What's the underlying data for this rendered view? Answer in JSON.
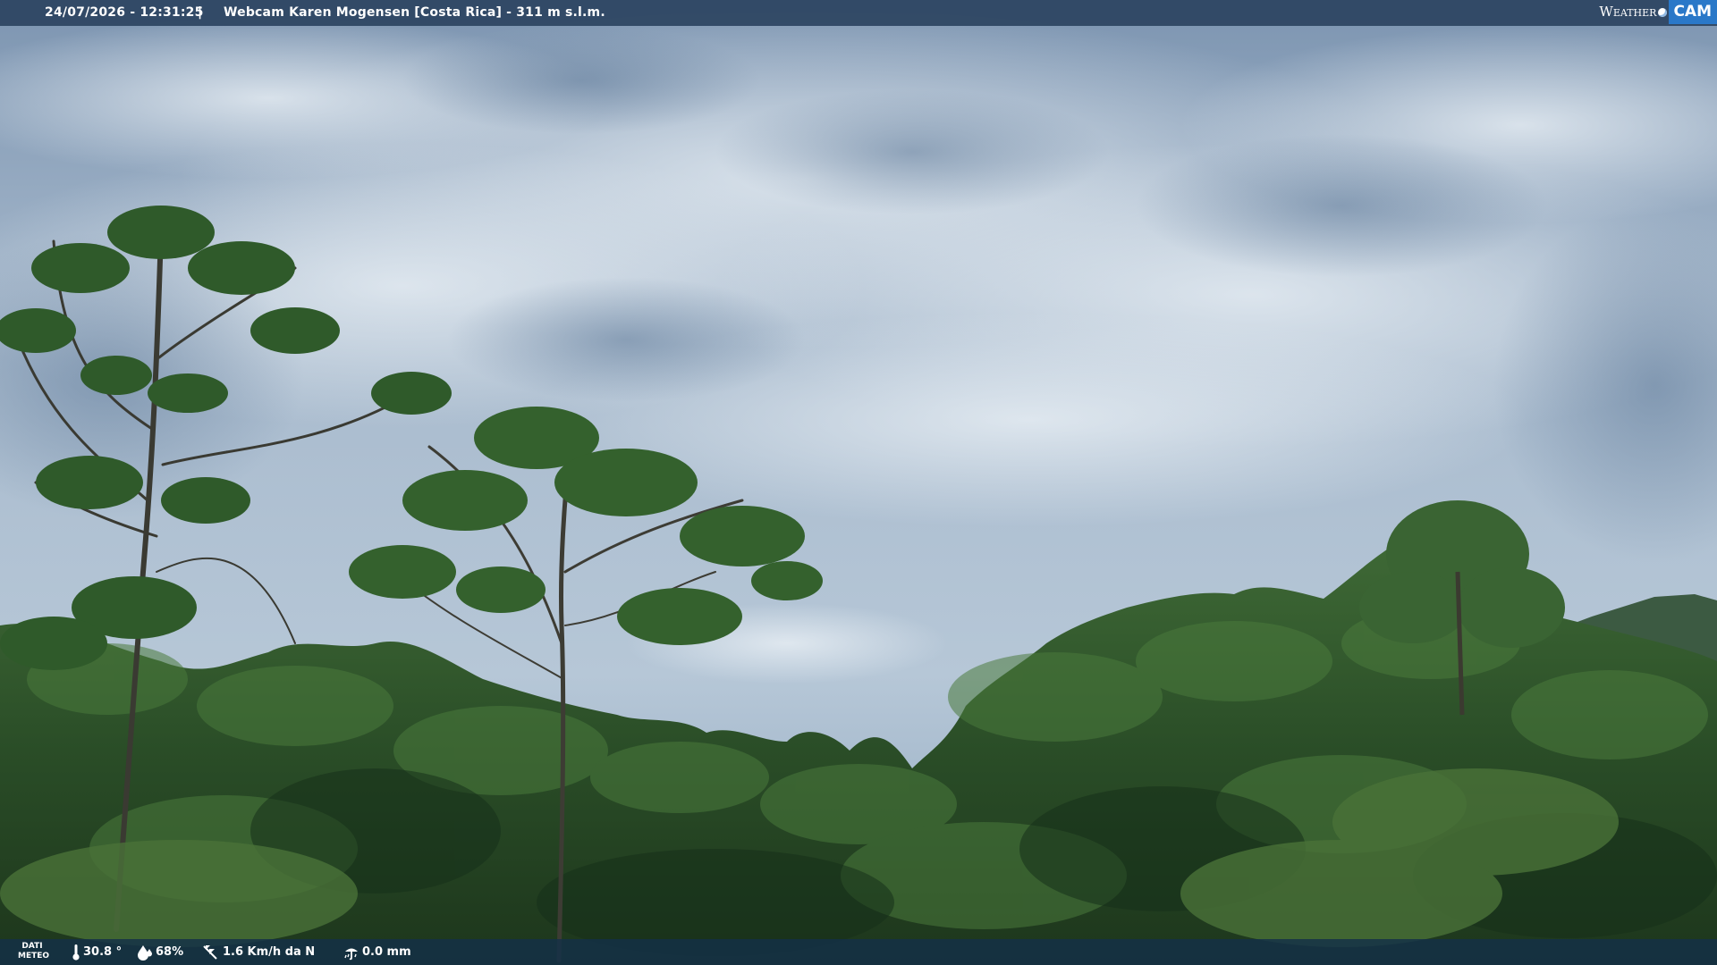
{
  "header": {
    "datetime": "24/07/2026 - 12:31:25",
    "separator": "|",
    "caption": "Webcam Karen Mogensen [Costa Rica] - 311 m s.l.m."
  },
  "logo": {
    "word1": "Weather",
    "word2": "CAM",
    "accent": "#2a78c8"
  },
  "weather": {
    "label_line1": "DATI",
    "label_line2": "METEO",
    "temperature": "30.8 °",
    "humidity": "68%",
    "wind": "1.6 Km/h da N",
    "rain": "0.0 mm",
    "icons": [
      "thermometer-icon",
      "humidity-drop-icon",
      "wind-icon",
      "rain-gauge-icon"
    ]
  },
  "colors": {
    "sky_top": "#7f97b3",
    "sky_bottom": "#b5c6d6",
    "foliage_dark": "#1f3a1e",
    "foliage_mid": "#2f5a2a",
    "foliage_light": "#4d7a3d"
  }
}
